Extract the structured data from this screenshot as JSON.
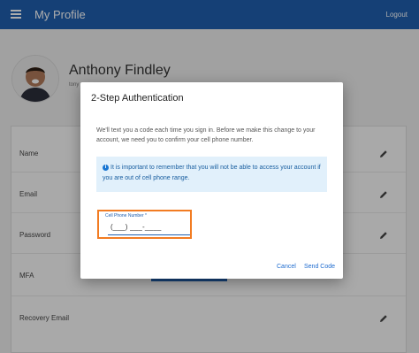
{
  "appbar": {
    "title": "My Profile",
    "logout_label": "Logout"
  },
  "profile": {
    "name": "Anthony Findley",
    "sub": "tony"
  },
  "settings": {
    "rows": [
      {
        "label": "Name"
      },
      {
        "label": "Email"
      },
      {
        "label": "Password"
      },
      {
        "label": "MFA"
      },
      {
        "label": "Recovery Email"
      }
    ]
  },
  "dialog": {
    "title": "2-Step Authentication",
    "description": "We'll text you a code each time you sign in. Before we make this change to your account, we need you to confirm your cell phone number.",
    "info": "It is important to remember that you will not be able to access your account if you are out of cell phone range.",
    "phone_label": "Cell Phone Number *",
    "phone_value": "(___) ___-____",
    "cancel_label": "Cancel",
    "send_label": "Send Code"
  },
  "colors": {
    "primary": "#1f5fae",
    "highlight": "#f27c22",
    "info_bg": "#e1f0fb"
  },
  "icons": [
    "menu-icon",
    "pencil-icon",
    "info-icon"
  ]
}
